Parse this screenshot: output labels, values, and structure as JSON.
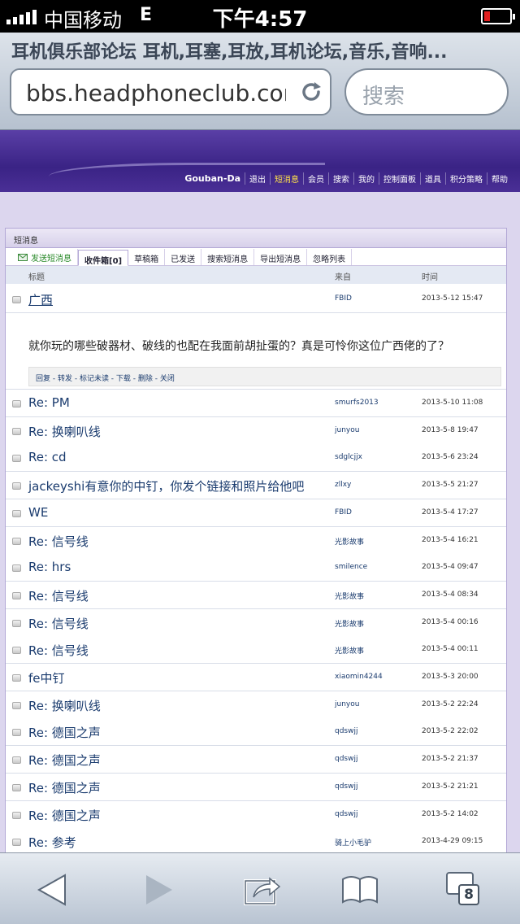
{
  "status": {
    "carrier": "中国移动",
    "network": "E",
    "time": "下午4:57"
  },
  "browser": {
    "title": "耳机俱乐部论坛 耳机,耳塞,耳放,耳机论坛,音乐,音响...",
    "url": "bbs.headphoneclub.com",
    "search_placeholder": "搜索",
    "tab_count": "8"
  },
  "nav": {
    "user": "Gouban-Da",
    "items": [
      "退出",
      "短消息",
      "会员",
      "搜索",
      "我的",
      "控制面板",
      "道具",
      "积分策略",
      "帮助"
    ]
  },
  "panel": {
    "title": "短消息",
    "tabs": [
      "发送短消息",
      "收件箱[0]",
      "草稿箱",
      "已发送",
      "搜索短消息",
      "导出短消息",
      "忽略列表"
    ],
    "headers": {
      "subject": "标题",
      "from": "来自",
      "time": "时间"
    },
    "open_message": {
      "subject": "广西",
      "from": "FBID",
      "time": "2013-5-12 15:47",
      "body": "就你玩的哪些破器材、破线的也配在我面前胡扯蛋的？真是可怜你这位广西佬的了？",
      "actions": "回复 - 转发 - 标记未读 - 下载 - 删除 - 关闭"
    },
    "messages": [
      {
        "subject": "Re: PM",
        "from": "smurfs2013",
        "time": "2013-5-10 11:08"
      },
      {
        "subject": "Re: 换喇叭线",
        "from": "junyou",
        "time": "2013-5-8 19:47"
      },
      {
        "subject": "Re: cd",
        "from": "sdglcjjx",
        "time": "2013-5-6 23:24"
      },
      {
        "subject": "jackeyshi有意你的中钉，你发个链接和照片给他吧",
        "from": "zllxy",
        "time": "2013-5-5 21:27"
      },
      {
        "subject": "WE",
        "from": "FBID",
        "time": "2013-5-4 17:27"
      },
      {
        "subject": "Re: 信号线",
        "from": "光影故事",
        "time": "2013-5-4 16:21"
      },
      {
        "subject": "Re: hrs",
        "from": "smilence",
        "time": "2013-5-4 09:47"
      },
      {
        "subject": "Re: 信号线",
        "from": "光影故事",
        "time": "2013-5-4 08:34"
      },
      {
        "subject": "Re: 信号线",
        "from": "光影故事",
        "time": "2013-5-4 00:16"
      },
      {
        "subject": "Re: 信号线",
        "from": "光影故事",
        "time": "2013-5-4 00:11"
      },
      {
        "subject": "fe中钉",
        "from": "xiaomin4244",
        "time": "2013-5-3 20:00"
      },
      {
        "subject": "Re: 换喇叭线",
        "from": "junyou",
        "time": "2013-5-2 22:24"
      },
      {
        "subject": "Re: 德国之声",
        "from": "qdswjj",
        "time": "2013-5-2 22:02"
      },
      {
        "subject": "Re: 德国之声",
        "from": "qdswjj",
        "time": "2013-5-2 21:37"
      },
      {
        "subject": "Re: 德国之声",
        "from": "qdswjj",
        "time": "2013-5-2 21:21"
      },
      {
        "subject": "Re: 德国之声",
        "from": "qdswjj",
        "time": "2013-5-2 14:02"
      },
      {
        "subject": "Re: 参考",
        "from": "骑上小毛驴",
        "time": "2013-4-29 09:15"
      }
    ]
  }
}
